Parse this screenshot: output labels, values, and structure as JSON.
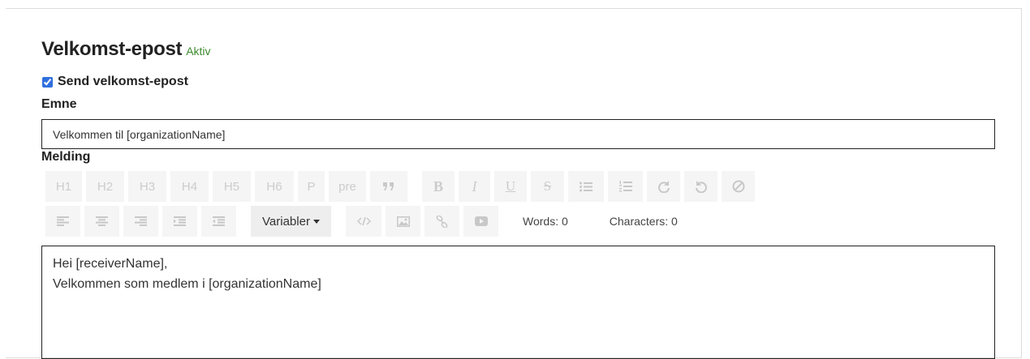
{
  "section": {
    "title": "Velkomst-epost",
    "status": "Aktiv",
    "accent_color": "#5cb83c",
    "status_color": "#3c8a2e"
  },
  "send_checkbox": {
    "label": "Send velkomst-epost",
    "checked": true
  },
  "subject": {
    "label": "Emne",
    "value": "Velkommen til [organizationName]"
  },
  "message": {
    "label": "Melding",
    "lines": [
      "Hei [receiverName],",
      "Velkommen som medlem i [organizationName]"
    ]
  },
  "toolbar": {
    "headings": [
      "H1",
      "H2",
      "H3",
      "H4",
      "H5",
      "H6",
      "P",
      "pre"
    ],
    "format_icons": [
      "quote-icon",
      "bold-icon",
      "italic-icon",
      "underline-icon",
      "strikethrough-icon",
      "bullet-list-icon",
      "numbered-list-icon",
      "redo-icon",
      "undo-icon",
      "clear-format-icon"
    ],
    "align_icons": [
      "align-left-icon",
      "align-center-icon",
      "align-right-icon",
      "indent-icon",
      "outdent-icon"
    ],
    "variables_label": "Variabler",
    "insert_icons": [
      "code-icon",
      "image-icon",
      "link-icon",
      "video-icon"
    ],
    "words_label": "Words: 0",
    "characters_label": "Characters: 0"
  }
}
